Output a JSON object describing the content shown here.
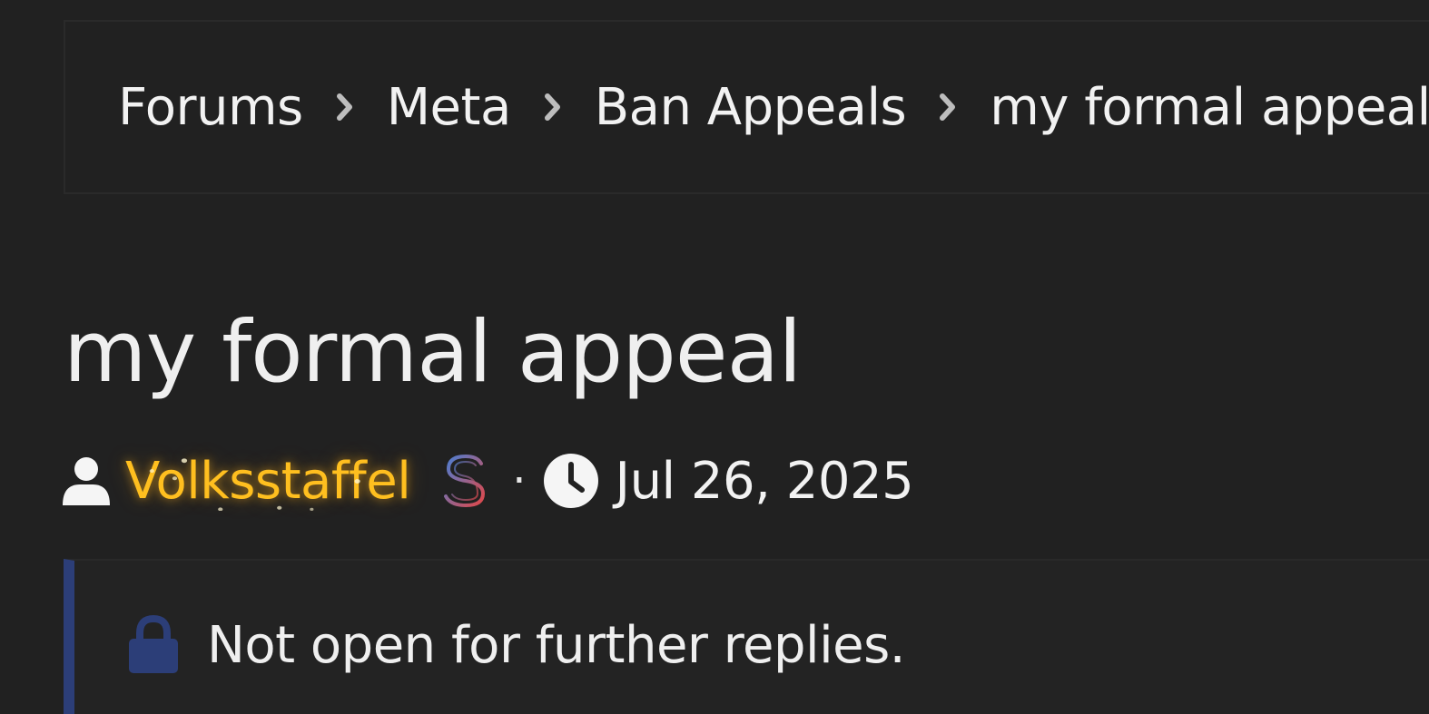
{
  "breadcrumb": {
    "items": [
      {
        "label": "Forums"
      },
      {
        "label": "Meta"
      },
      {
        "label": "Ban Appeals"
      },
      {
        "label": "my formal appeal"
      }
    ]
  },
  "thread": {
    "title": "my formal appeal",
    "author": "Volksstaffel",
    "date": "Jul 26, 2025",
    "separator": "·"
  },
  "notice": {
    "text": "Not open for further replies."
  },
  "icons": {
    "breadcrumb_separator": "chevron-right-icon",
    "author": "user-icon",
    "badge": "dollar-sign-icon",
    "date": "clock-icon",
    "notice": "lock-icon"
  },
  "colors": {
    "background": "#212121",
    "username": "#ffbf1f",
    "notice_accent": "#2c3e78",
    "lock": "#2c3e78",
    "dollar_gradient": [
      "#4a7fd4",
      "#e0484a"
    ]
  }
}
